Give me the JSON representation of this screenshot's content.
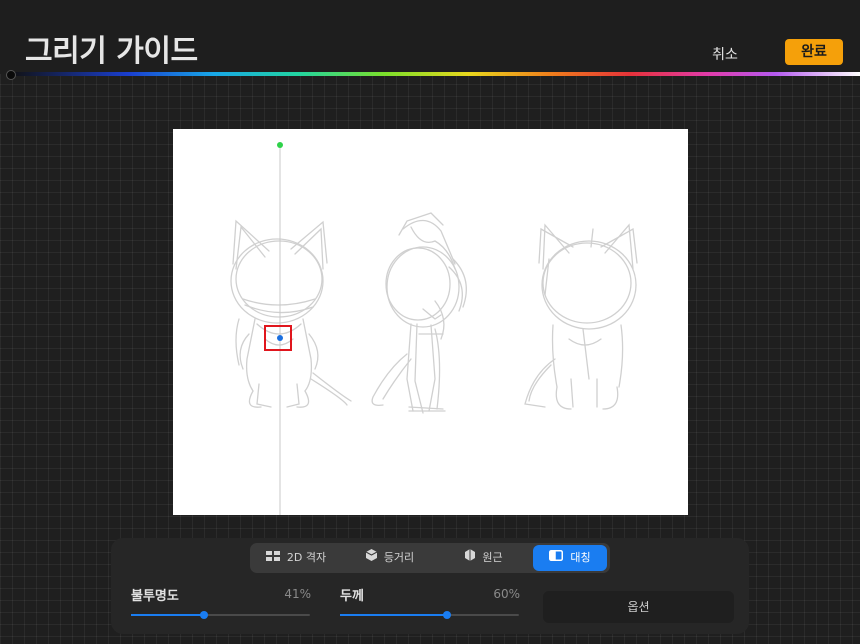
{
  "header": {
    "title": "그리기 가이드",
    "cancel_label": "취소",
    "done_label": "완료",
    "accent_color": "#f5a00a"
  },
  "color_bar": {
    "icon": "hue-slider"
  },
  "canvas": {
    "background": "#ffffff",
    "guide": "symmetry-vertical",
    "handle_colors": {
      "top": "#2ed24a",
      "center": "#1a6fe0"
    },
    "content": "sketch of three character turnaround poses"
  },
  "guide_modes": [
    {
      "label": "2D 격자",
      "icon": "grid-2d-icon",
      "active": false
    },
    {
      "label": "등거리",
      "icon": "isometric-icon",
      "active": false
    },
    {
      "label": "원근",
      "icon": "perspective-icon",
      "active": false
    },
    {
      "label": "대칭",
      "icon": "symmetry-icon",
      "active": true
    }
  ],
  "sliders": {
    "opacity": {
      "label": "불투명도",
      "value_text": "41%",
      "value": 0.41
    },
    "thickness": {
      "label": "두께",
      "value_text": "60%",
      "value": 0.6
    }
  },
  "options_label": "옵션",
  "accent_blue": "#1a7df1"
}
